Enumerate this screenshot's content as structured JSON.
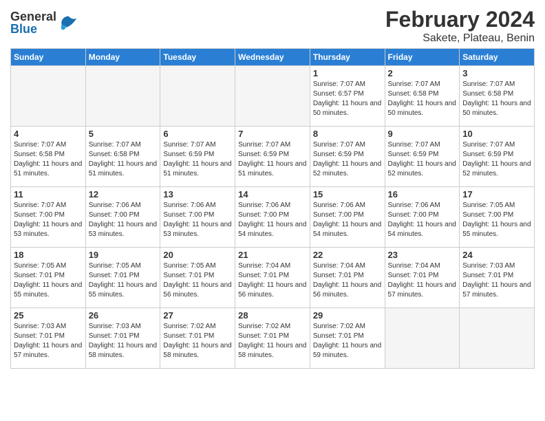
{
  "header": {
    "logo_general": "General",
    "logo_blue": "Blue",
    "title": "February 2024",
    "location": "Sakete, Plateau, Benin"
  },
  "days_of_week": [
    "Sunday",
    "Monday",
    "Tuesday",
    "Wednesday",
    "Thursday",
    "Friday",
    "Saturday"
  ],
  "weeks": [
    [
      {
        "day": "",
        "empty": true
      },
      {
        "day": "",
        "empty": true
      },
      {
        "day": "",
        "empty": true
      },
      {
        "day": "",
        "empty": true
      },
      {
        "day": "1",
        "sunrise": "7:07 AM",
        "sunset": "6:57 PM",
        "daylight": "11 hours and 50 minutes."
      },
      {
        "day": "2",
        "sunrise": "7:07 AM",
        "sunset": "6:58 PM",
        "daylight": "11 hours and 50 minutes."
      },
      {
        "day": "3",
        "sunrise": "7:07 AM",
        "sunset": "6:58 PM",
        "daylight": "11 hours and 50 minutes."
      }
    ],
    [
      {
        "day": "4",
        "sunrise": "7:07 AM",
        "sunset": "6:58 PM",
        "daylight": "11 hours and 51 minutes."
      },
      {
        "day": "5",
        "sunrise": "7:07 AM",
        "sunset": "6:58 PM",
        "daylight": "11 hours and 51 minutes."
      },
      {
        "day": "6",
        "sunrise": "7:07 AM",
        "sunset": "6:59 PM",
        "daylight": "11 hours and 51 minutes."
      },
      {
        "day": "7",
        "sunrise": "7:07 AM",
        "sunset": "6:59 PM",
        "daylight": "11 hours and 51 minutes."
      },
      {
        "day": "8",
        "sunrise": "7:07 AM",
        "sunset": "6:59 PM",
        "daylight": "11 hours and 52 minutes."
      },
      {
        "day": "9",
        "sunrise": "7:07 AM",
        "sunset": "6:59 PM",
        "daylight": "11 hours and 52 minutes."
      },
      {
        "day": "10",
        "sunrise": "7:07 AM",
        "sunset": "6:59 PM",
        "daylight": "11 hours and 52 minutes."
      }
    ],
    [
      {
        "day": "11",
        "sunrise": "7:07 AM",
        "sunset": "7:00 PM",
        "daylight": "11 hours and 53 minutes."
      },
      {
        "day": "12",
        "sunrise": "7:06 AM",
        "sunset": "7:00 PM",
        "daylight": "11 hours and 53 minutes."
      },
      {
        "day": "13",
        "sunrise": "7:06 AM",
        "sunset": "7:00 PM",
        "daylight": "11 hours and 53 minutes."
      },
      {
        "day": "14",
        "sunrise": "7:06 AM",
        "sunset": "7:00 PM",
        "daylight": "11 hours and 54 minutes."
      },
      {
        "day": "15",
        "sunrise": "7:06 AM",
        "sunset": "7:00 PM",
        "daylight": "11 hours and 54 minutes."
      },
      {
        "day": "16",
        "sunrise": "7:06 AM",
        "sunset": "7:00 PM",
        "daylight": "11 hours and 54 minutes."
      },
      {
        "day": "17",
        "sunrise": "7:05 AM",
        "sunset": "7:00 PM",
        "daylight": "11 hours and 55 minutes."
      }
    ],
    [
      {
        "day": "18",
        "sunrise": "7:05 AM",
        "sunset": "7:01 PM",
        "daylight": "11 hours and 55 minutes."
      },
      {
        "day": "19",
        "sunrise": "7:05 AM",
        "sunset": "7:01 PM",
        "daylight": "11 hours and 55 minutes."
      },
      {
        "day": "20",
        "sunrise": "7:05 AM",
        "sunset": "7:01 PM",
        "daylight": "11 hours and 56 minutes."
      },
      {
        "day": "21",
        "sunrise": "7:04 AM",
        "sunset": "7:01 PM",
        "daylight": "11 hours and 56 minutes."
      },
      {
        "day": "22",
        "sunrise": "7:04 AM",
        "sunset": "7:01 PM",
        "daylight": "11 hours and 56 minutes."
      },
      {
        "day": "23",
        "sunrise": "7:04 AM",
        "sunset": "7:01 PM",
        "daylight": "11 hours and 57 minutes."
      },
      {
        "day": "24",
        "sunrise": "7:03 AM",
        "sunset": "7:01 PM",
        "daylight": "11 hours and 57 minutes."
      }
    ],
    [
      {
        "day": "25",
        "sunrise": "7:03 AM",
        "sunset": "7:01 PM",
        "daylight": "11 hours and 57 minutes."
      },
      {
        "day": "26",
        "sunrise": "7:03 AM",
        "sunset": "7:01 PM",
        "daylight": "11 hours and 58 minutes."
      },
      {
        "day": "27",
        "sunrise": "7:02 AM",
        "sunset": "7:01 PM",
        "daylight": "11 hours and 58 minutes."
      },
      {
        "day": "28",
        "sunrise": "7:02 AM",
        "sunset": "7:01 PM",
        "daylight": "11 hours and 58 minutes."
      },
      {
        "day": "29",
        "sunrise": "7:02 AM",
        "sunset": "7:01 PM",
        "daylight": "11 hours and 59 minutes."
      },
      {
        "day": "",
        "empty": true
      },
      {
        "day": "",
        "empty": true
      }
    ]
  ]
}
